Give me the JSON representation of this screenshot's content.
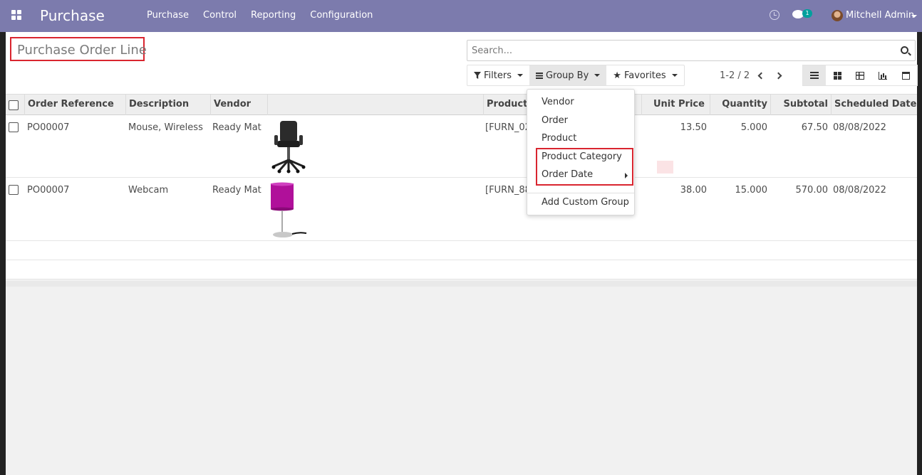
{
  "navbar": {
    "app_name": "Purchase",
    "menu": [
      "Purchase",
      "Control",
      "Reporting",
      "Configuration"
    ],
    "chat_badge": "1",
    "user": "Mitchell Admin",
    "color": "#7c7bad"
  },
  "control_panel": {
    "title": "Purchase Order Line",
    "search_placeholder": "Search...",
    "buttons": {
      "filters": "Filters",
      "group_by": "Group By",
      "favorites": "Favorites"
    },
    "pager": "1-2 / 2",
    "views": [
      "list-icon",
      "kanban-icon",
      "pivot-icon",
      "graph-icon",
      "calendar-icon"
    ]
  },
  "table": {
    "columns": [
      "Order Reference",
      "Description",
      "Vendor",
      "",
      "Product",
      "Unit Price",
      "Quantity",
      "Subtotal",
      "Scheduled Date"
    ],
    "rows": [
      {
        "order_ref": "PO00007",
        "description": "Mouse, Wireless",
        "vendor": "Ready Mat",
        "product": "[FURN_02",
        "unit_price": "13.50",
        "quantity": "5.000",
        "subtotal": "67.50",
        "date": "08/08/2022",
        "image": "office-chair"
      },
      {
        "order_ref": "PO00007",
        "description": "Webcam",
        "vendor": "Ready Mat",
        "product": "[FURN_88",
        "unit_price": "38.00",
        "quantity": "15.000",
        "subtotal": "570.00",
        "date": "08/08/2022",
        "image": "purple-lamp"
      }
    ]
  },
  "group_by_menu": {
    "items": [
      "Vendor",
      "Order",
      "Product",
      "Product Category",
      "Order Date"
    ],
    "custom": "Add Custom Group"
  },
  "highlight_color": "#d9252f"
}
